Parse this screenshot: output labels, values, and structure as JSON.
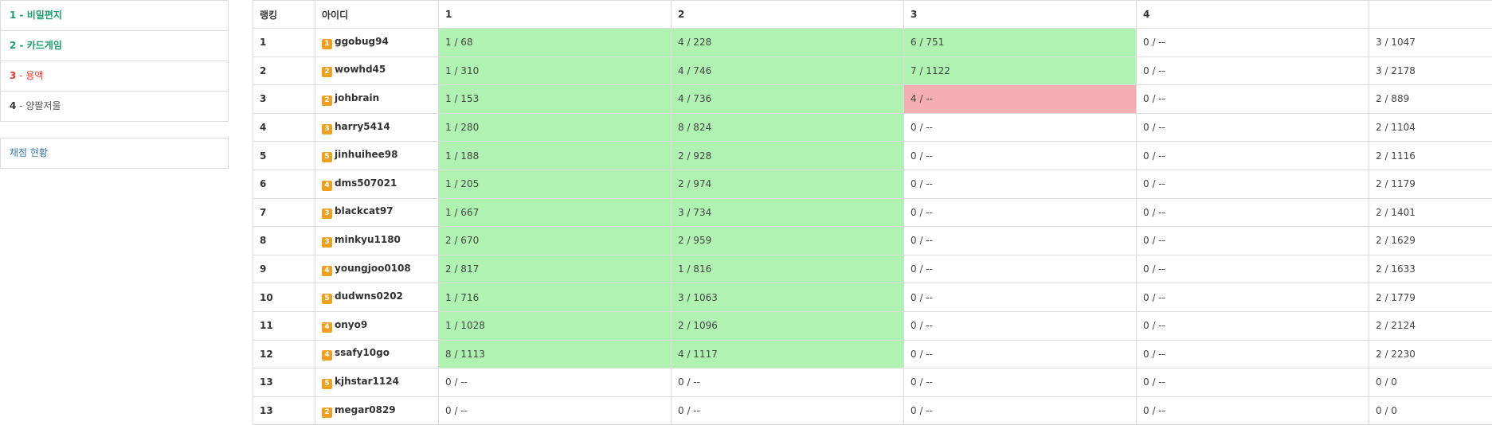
{
  "problems": [
    {
      "num": "1",
      "name": " - 비밀편지",
      "status": "solved"
    },
    {
      "num": "2",
      "name": " - 카드게임",
      "status": "solved"
    },
    {
      "num": "3",
      "name": " - 용액",
      "status": "failed"
    },
    {
      "num": "4",
      "name": " - 양팔저울",
      "status": "none"
    }
  ],
  "status_link": "채점 현황",
  "table": {
    "headers": [
      "랭킹",
      "아이디",
      "1",
      "2",
      "3",
      "4",
      ""
    ],
    "rows": [
      {
        "rank": "1",
        "badge": "1",
        "user": "ggobug94",
        "cells": [
          "1 / 68",
          "4 / 228",
          "6 / 751",
          "0 / --"
        ],
        "states": [
          "ok",
          "ok",
          "ok",
          ""
        ],
        "total": "3 / 1047"
      },
      {
        "rank": "2",
        "badge": "2",
        "user": "wowhd45",
        "cells": [
          "1 / 310",
          "4 / 746",
          "7 / 1122",
          "0 / --"
        ],
        "states": [
          "ok",
          "ok",
          "ok",
          ""
        ],
        "total": "3 / 2178"
      },
      {
        "rank": "3",
        "badge": "2",
        "user": "johbrain",
        "cells": [
          "1 / 153",
          "4 / 736",
          "4 / --",
          "0 / --"
        ],
        "states": [
          "ok",
          "ok",
          "bad",
          ""
        ],
        "total": "2 / 889"
      },
      {
        "rank": "4",
        "badge": "3",
        "user": "harry5414",
        "cells": [
          "1 / 280",
          "8 / 824",
          "0 / --",
          "0 / --"
        ],
        "states": [
          "ok",
          "ok",
          "",
          ""
        ],
        "total": "2 / 1104"
      },
      {
        "rank": "5",
        "badge": "5",
        "user": "jinhuihee98",
        "cells": [
          "1 / 188",
          "2 / 928",
          "0 / --",
          "0 / --"
        ],
        "states": [
          "ok",
          "ok",
          "",
          ""
        ],
        "total": "2 / 1116"
      },
      {
        "rank": "6",
        "badge": "4",
        "user": "dms507021",
        "cells": [
          "1 / 205",
          "2 / 974",
          "0 / --",
          "0 / --"
        ],
        "states": [
          "ok",
          "ok",
          "",
          ""
        ],
        "total": "2 / 1179"
      },
      {
        "rank": "7",
        "badge": "3",
        "user": "blackcat97",
        "cells": [
          "1 / 667",
          "3 / 734",
          "0 / --",
          "0 / --"
        ],
        "states": [
          "ok",
          "ok",
          "",
          ""
        ],
        "total": "2 / 1401"
      },
      {
        "rank": "8",
        "badge": "3",
        "user": "minkyu1180",
        "cells": [
          "2 / 670",
          "2 / 959",
          "0 / --",
          "0 / --"
        ],
        "states": [
          "ok",
          "ok",
          "",
          ""
        ],
        "total": "2 / 1629"
      },
      {
        "rank": "9",
        "badge": "4",
        "user": "youngjoo0108",
        "cells": [
          "2 / 817",
          "1 / 816",
          "0 / --",
          "0 / --"
        ],
        "states": [
          "ok",
          "ok",
          "",
          ""
        ],
        "total": "2 / 1633"
      },
      {
        "rank": "10",
        "badge": "5",
        "user": "dudwns0202",
        "cells": [
          "1 / 716",
          "3 / 1063",
          "0 / --",
          "0 / --"
        ],
        "states": [
          "ok",
          "ok",
          "",
          ""
        ],
        "total": "2 / 1779"
      },
      {
        "rank": "11",
        "badge": "4",
        "user": "onyo9",
        "cells": [
          "1 / 1028",
          "2 / 1096",
          "0 / --",
          "0 / --"
        ],
        "states": [
          "ok",
          "ok",
          "",
          ""
        ],
        "total": "2 / 2124"
      },
      {
        "rank": "12",
        "badge": "4",
        "user": "ssafy10go",
        "cells": [
          "8 / 1113",
          "4 / 1117",
          "0 / --",
          "0 / --"
        ],
        "states": [
          "ok",
          "ok",
          "",
          ""
        ],
        "total": "2 / 2230"
      },
      {
        "rank": "13",
        "badge": "5",
        "user": "kjhstar1124",
        "cells": [
          "0 / --",
          "0 / --",
          "0 / --",
          "0 / --"
        ],
        "states": [
          "",
          "",
          "",
          ""
        ],
        "total": "0 / 0"
      },
      {
        "rank": "13",
        "badge": "2",
        "user": "megar0829",
        "cells": [
          "0 / --",
          "0 / --",
          "0 / --",
          "0 / --"
        ],
        "states": [
          "",
          "",
          "",
          ""
        ],
        "total": "0 / 0"
      }
    ]
  }
}
